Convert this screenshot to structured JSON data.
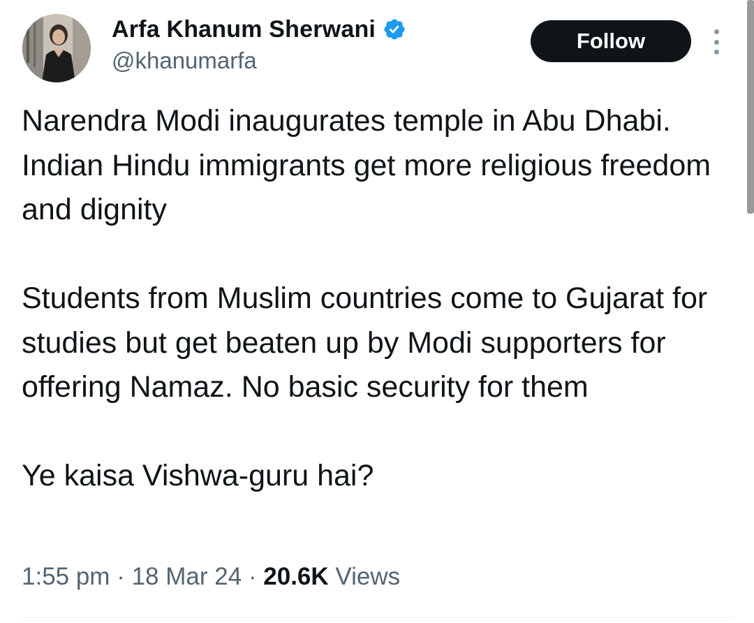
{
  "author": {
    "display_name": "Arfa Khanum Sherwani",
    "handle": "@khanumarfa",
    "verified": true,
    "verified_icon": "verified-badge-icon"
  },
  "actions": {
    "follow_label": "Follow",
    "more_icon": "more-vertical-icon"
  },
  "tweet": {
    "paragraphs": [
      "Narendra Modi inaugurates temple in Abu Dhabi. Indian Hindu immigrants get more religious freedom and dignity",
      "Students from Muslim countries come to Gujarat for studies but get beaten up by Modi supporters for offering Namaz. No basic security for them",
      "Ye kaisa Vishwa-guru hai?"
    ],
    "time": "1:55 pm",
    "date": "18 Mar 24",
    "separator": " · ",
    "views_count": "20.6K",
    "views_label": "Views"
  },
  "colors": {
    "text_primary": "#0f1419",
    "text_secondary": "#536471",
    "verified_blue": "#1d9bf0",
    "follow_bg": "#0f1419"
  }
}
